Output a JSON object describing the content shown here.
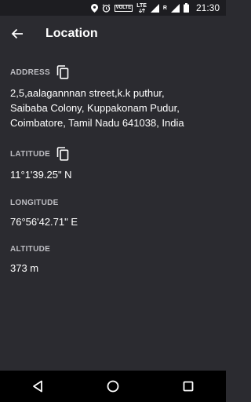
{
  "status_bar": {
    "time": "21:30",
    "volte_label": "VOLTE",
    "lte_label": "LTE",
    "roaming_label": "R",
    "icons": [
      "location-icon",
      "alarm-icon",
      "volte-icon",
      "lte-signal-icon",
      "signal-icon",
      "battery-icon"
    ]
  },
  "app_bar": {
    "title": "Location",
    "back_icon": "arrow-left-icon"
  },
  "sections": {
    "address": {
      "label": "ADDRESS",
      "value_line1": "2,5,aalagannnan street,k.k puthur,",
      "value_line2": "Saibaba Colony, Kuppakonam Pudur,",
      "value_line3": "Coimbatore, Tamil Nadu 641038, India",
      "copy_icon": "copy-icon"
    },
    "latitude": {
      "label": "LATITUDE",
      "value": "11°1'39.25\" N",
      "copy_icon": "copy-icon"
    },
    "longitude": {
      "label": "LONGITUDE",
      "value": "76°56'42.71\" E"
    },
    "altitude": {
      "label": "ALTITUDE",
      "value": "373 m"
    }
  },
  "nav_bar": {
    "icons": [
      "back-triangle-icon",
      "home-circle-icon",
      "recents-square-icon"
    ]
  },
  "colors": {
    "background": "#2b2b30",
    "status_bar": "#1d1d21",
    "nav_bar": "#000000",
    "label": "#bdbdc2",
    "value": "#ffffff"
  }
}
